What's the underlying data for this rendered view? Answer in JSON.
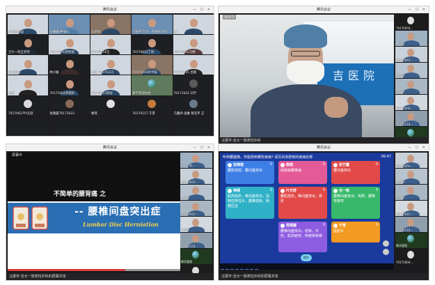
{
  "panes": [
    {
      "title": "腾讯会议",
      "status": "",
      "tiles": [
        {
          "name": "多肝胆梓园"
        },
        {
          "name": "丛姗姗 肿瘤科"
        },
        {
          "name": "总老师"
        },
        {
          "name": "汪振宇 吉大一院脊柱外科"
        },
        {
          "name": "葛"
        },
        {
          "name": "吉大一院王老师"
        },
        {
          "name": "70170050贾晓丽"
        },
        {
          "name": "70170218王"
        },
        {
          "name": "70170833丁扬"
        },
        {
          "name": "70170910马腾"
        },
        {
          "name": "羿王思成"
        },
        {
          "name": "林小媛"
        },
        {
          "name": "高婧 70170225"
        },
        {
          "name": "70170604卷平聪"
        },
        {
          "name": "70170935 吕薇"
        },
        {
          "name": "晓丽"
        },
        {
          "name": "70171004李梓阳"
        },
        {
          "name": "70170914梁舒"
        },
        {
          "name": "教学管理协会"
        },
        {
          "name": "70171022 刘学"
        },
        {
          "name": "70170627叶天舒"
        },
        {
          "name": "张晓晨70171023"
        },
        {
          "name": "谢瑶"
        },
        {
          "name": "70170217 于雪"
        },
        {
          "name": "马鑫炜 张康 蒋浩宇 王"
        }
      ]
    },
    {
      "title": "腾讯会议",
      "tag": "演讲中",
      "status": "汪振宇-吉大一院脊柱外科",
      "sign_text": "吉医院",
      "sidebar": [
        {
          "name": "70170050..."
        },
        {
          "name": "林小媛"
        },
        {
          "name": "70170910..."
        },
        {
          "name": "王思成"
        },
        {
          "name": "龙老师"
        },
        {
          "name": "70171004..."
        },
        {
          "name": "70170218..."
        },
        {
          "name": "教学管理"
        }
      ]
    },
    {
      "title": "腾讯会议",
      "tag": "屏幕中",
      "status": "汪振宇-吉大一院脊柱外科的屏幕共享",
      "slide": {
        "title": "不简单的腰背痛 之",
        "main": "-- 腰椎间盘突出症",
        "sub": "Lumbar Disc Herniation"
      },
      "progress": 0.68,
      "sidebar": [
        {
          "name": "吉大一院..."
        },
        {
          "name": "70170050..."
        },
        {
          "name": "林小媛"
        },
        {
          "name": "70170910..."
        },
        {
          "name": "王思成"
        },
        {
          "name": "70170218..."
        },
        {
          "name": "教学管理"
        },
        {
          "name": "70171004..."
        }
      ]
    },
    {
      "title": "腾讯会议",
      "status": "汪振宇-吉大一院脊柱外科的屏幕共享",
      "poll": {
        "question": "听到腰腿痛，你能想到哪些疾病? 请写出你想到的疾病名称",
        "timer": "06:47",
        "button": "提交",
        "cards": [
          {
            "who": "张婧瑗",
            "score": "0",
            "text": "腰肌劳损、腰间盘突出",
            "color": "blue"
          },
          {
            "who": "高婧",
            "score": "0",
            "text": "结核病腰椎病",
            "color": "pink"
          },
          {
            "who": "张艺馨",
            "score": "0",
            "text": "腰间盘突出",
            "color": "red"
          },
          {
            "who": "钟晴",
            "score": "0",
            "text": "肌肉损伤，椎间盘突出，强制性脊柱炎，腰椎感染，肿瘤压迫",
            "color": "cyan"
          },
          {
            "who": "叶天舒",
            "score": "0",
            "text": "腰肌损伤，椎间盘突出，骨折",
            "color": "red"
          },
          {
            "who": "任一帆",
            "score": "0",
            "text": "腰椎间盘突出，骨质，腰椎管狭窄",
            "color": "green"
          },
          {
            "who": "周靖娜",
            "score": "0",
            "text": "腰椎间盘突出，结核，外伤，肌肉疲劳，肿瘤骨转移",
            "color": "purple"
          },
          {
            "who": "于雪",
            "score": "0",
            "text": "盆腔炎",
            "color": "orange"
          }
        ]
      },
      "sidebar": [
        {
          "name": "70170050..."
        },
        {
          "name": "林小媛"
        },
        {
          "name": "王思成"
        },
        {
          "name": "70170910..."
        },
        {
          "name": "70170218..."
        },
        {
          "name": "教学管理"
        },
        {
          "name": "70171004..."
        }
      ]
    }
  ]
}
